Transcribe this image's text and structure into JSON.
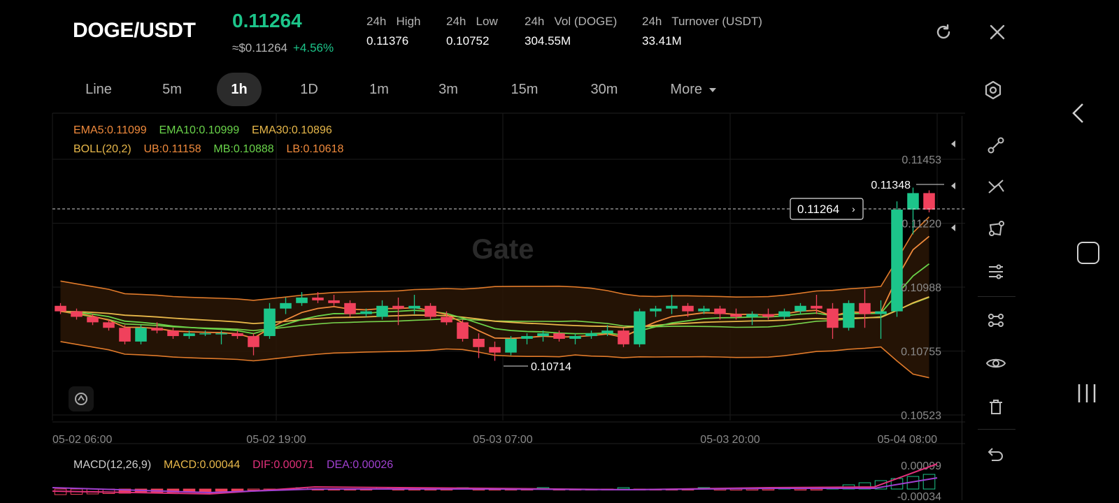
{
  "header": {
    "pair": "DOGE/USDT",
    "price": "0.11264",
    "usd_price": "≈$0.11264",
    "change": "+4.56%",
    "stats": [
      {
        "label": "24h   High",
        "value": "0.11376"
      },
      {
        "label": "24h   Low",
        "value": "0.10752"
      },
      {
        "label": "24h   Vol (DOGE)",
        "value": "304.55M"
      },
      {
        "label": "24h   Turnover (USDT)",
        "value": "33.41M"
      }
    ]
  },
  "tabs": [
    "Line",
    "5m",
    "1h",
    "1D",
    "1m",
    "3m",
    "15m",
    "30m",
    "More"
  ],
  "active_tab": "1h",
  "indicators": {
    "ema5": "EMA5:0.11099",
    "ema10": "EMA10:0.10999",
    "ema30": "EMA30:0.10896",
    "boll": "BOLL(20,2)",
    "ub": "UB:0.11158",
    "mb": "MB:0.10888",
    "lb": "LB:0.10618",
    "macd_name": "MACD(12,26,9)",
    "macd": "MACD:0.00044",
    "dif": "DIF:0.00071",
    "dea": "DEA:0.00026"
  },
  "watermark": "Gate",
  "colors": {
    "up": "#1cc58a",
    "down": "#f0415c",
    "ema5": "#f08a3c",
    "ema10": "#6ad44a",
    "ema30": "#e8b84a",
    "boll_band": "#e07a2a",
    "mb": "#78d44c",
    "dif": "#e0307a",
    "dea": "#a040d0"
  },
  "chart_data": {
    "type": "candlestick",
    "y_ticks": [
      "0.11453",
      "0.11220",
      "0.10988",
      "0.10755",
      "0.10523"
    ],
    "x_ticks": [
      "05-02 06:00",
      "05-02 19:00",
      "05-03 07:00",
      "05-03 20:00",
      "05-04 08:00"
    ],
    "current_price": "0.11264",
    "high_marker": "0.11348",
    "low_marker": "0.10714",
    "ylim": [
      0.10523,
      0.11453
    ],
    "macd_ticks": [
      "0.00099",
      "-0.00034"
    ],
    "candles": [
      [
        0.1092,
        0.1093,
        0.1089,
        0.109
      ],
      [
        0.109,
        0.1091,
        0.1087,
        0.1088
      ],
      [
        0.1088,
        0.1089,
        0.1085,
        0.1086
      ],
      [
        0.1086,
        0.1087,
        0.1083,
        0.1084
      ],
      [
        0.1084,
        0.1085,
        0.1078,
        0.1079
      ],
      [
        0.1079,
        0.1085,
        0.1078,
        0.1084
      ],
      [
        0.1084,
        0.1086,
        0.1082,
        0.1083
      ],
      [
        0.1083,
        0.1084,
        0.108,
        0.1081
      ],
      [
        0.1081,
        0.1083,
        0.108,
        0.1082
      ],
      [
        0.1082,
        0.1083,
        0.1081,
        0.1082
      ],
      [
        0.1082,
        0.1083,
        0.1078,
        0.1082
      ],
      [
        0.1082,
        0.1083,
        0.108,
        0.1081
      ],
      [
        0.1081,
        0.1082,
        0.1074,
        0.1077
      ],
      [
        0.1081,
        0.1093,
        0.108,
        0.1091
      ],
      [
        0.1091,
        0.1095,
        0.1089,
        0.1093
      ],
      [
        0.1093,
        0.1097,
        0.1092,
        0.1095
      ],
      [
        0.1095,
        0.1097,
        0.1093,
        0.1094
      ],
      [
        0.1094,
        0.1096,
        0.1092,
        0.1093
      ],
      [
        0.1093,
        0.1094,
        0.1088,
        0.1089
      ],
      [
        0.1089,
        0.1091,
        0.1088,
        0.109
      ],
      [
        0.1088,
        0.1094,
        0.1087,
        0.1092
      ],
      [
        0.1092,
        0.1095,
        0.1085,
        0.1091
      ],
      [
        0.1091,
        0.1096,
        0.1089,
        0.1092
      ],
      [
        0.1092,
        0.1093,
        0.1087,
        0.1088
      ],
      [
        0.1088,
        0.109,
        0.1085,
        0.1086
      ],
      [
        0.1086,
        0.1087,
        0.1079,
        0.108
      ],
      [
        0.108,
        0.1082,
        0.1073,
        0.1077
      ],
      [
        0.1077,
        0.1079,
        0.1072,
        0.1075
      ],
      [
        0.1075,
        0.1081,
        0.1074,
        0.108
      ],
      [
        0.108,
        0.1082,
        0.1078,
        0.1081
      ],
      [
        0.1081,
        0.1083,
        0.1079,
        0.1082
      ],
      [
        0.1082,
        0.1083,
        0.1079,
        0.108
      ],
      [
        0.108,
        0.1082,
        0.1078,
        0.1081
      ],
      [
        0.1081,
        0.1083,
        0.108,
        0.1082
      ],
      [
        0.1082,
        0.1085,
        0.1081,
        0.1083
      ],
      [
        0.1083,
        0.1084,
        0.1077,
        0.1078
      ],
      [
        0.1078,
        0.1091,
        0.1077,
        0.109
      ],
      [
        0.109,
        0.1092,
        0.1088,
        0.1091
      ],
      [
        0.1091,
        0.1096,
        0.1089,
        0.1092
      ],
      [
        0.1092,
        0.1093,
        0.1088,
        0.109
      ],
      [
        0.109,
        0.1092,
        0.1089,
        0.1091
      ],
      [
        0.1091,
        0.1092,
        0.1087,
        0.1089
      ],
      [
        0.1089,
        0.1091,
        0.1087,
        0.1088
      ],
      [
        0.1088,
        0.109,
        0.1085,
        0.1089
      ],
      [
        0.1089,
        0.1091,
        0.1087,
        0.1088
      ],
      [
        0.1088,
        0.1091,
        0.1087,
        0.109
      ],
      [
        0.109,
        0.1093,
        0.1089,
        0.1092
      ],
      [
        0.1092,
        0.1096,
        0.1089,
        0.1091
      ],
      [
        0.1091,
        0.1093,
        0.108,
        0.1084
      ],
      [
        0.1084,
        0.1094,
        0.1083,
        0.1093
      ],
      [
        0.1093,
        0.1098,
        0.1084,
        0.1089
      ],
      [
        0.1089,
        0.1094,
        0.108,
        0.109
      ],
      [
        0.109,
        0.113,
        0.1088,
        0.1127
      ],
      [
        0.1127,
        0.1135,
        0.1118,
        0.1133
      ],
      [
        0.1133,
        0.1134,
        0.1126,
        0.1127
      ]
    ]
  }
}
